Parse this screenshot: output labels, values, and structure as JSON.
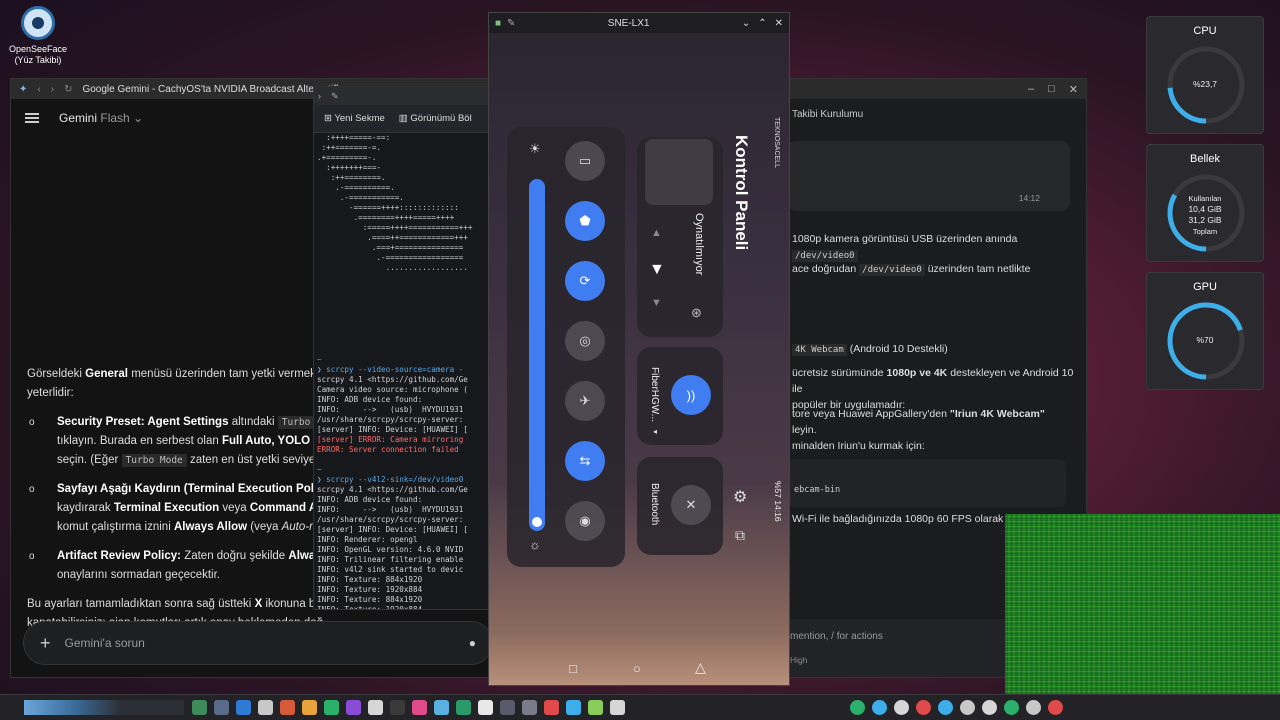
{
  "desktop": {
    "icon_label_1": "OpenSeeFace",
    "icon_label_2": "(Yüz Takibi)"
  },
  "browser": {
    "tab_title": "Google Gemini - CachyOS'ta NVIDIA Broadcast Alternatifle",
    "app_name": "Gemini",
    "model": "Flash",
    "intro": "menüsü üzerinden tam yetki vermek için",
    "intro_prefix": "Görseldeki",
    "intro_bold": "General",
    "intro_end": "yeterlidir:",
    "items": [
      {
        "title": "Security Preset: Agent Settings",
        "text1": "altındaki",
        "code": "Turbo Mo",
        "text2": "tıklayın. Burada en serbest olan",
        "b2": "Full Auto, YOLO Moc",
        "text3": "seçin. (Eğer",
        "code2": "Turbo Mode",
        "text4": "zaten en üst yetki seviyesi"
      },
      {
        "title": "Sayfayı Aşağı Kaydırın (Terminal Execution Policy):",
        "text1": "kaydırarak",
        "b1": "Terminal Execution",
        "text2": "veya",
        "b2": "Command Auto",
        "text3": "komut çalıştırma iznini",
        "b3": "Always Allow",
        "text4": "(veya",
        "i4": "Auto-run"
      },
      {
        "title": "Artifact Review Policy:",
        "text1": "Zaten doğru şekilde",
        "b1": "Always",
        "text2": "onaylarını sormadan geçecektir."
      }
    ],
    "closing_1": "Bu ayarları tamamladıktan sonra sağ üstteki",
    "closing_b": "X",
    "closing_2": "ikonuna basa",
    "closing_3": "kapatabilirsiniz; ajan komutları artık onay beklemeden doğ",
    "input_placeholder": "Gemini'a sorun"
  },
  "terminal": {
    "tab_new": "Yeni Sekme",
    "tab_split": "Görünümü Böl",
    "art": [
      "  :++++=====-==:",
      " :++=======-=.",
      ".+=========-.",
      "  :+++++++===-",
      "   :++========.",
      "    .-==========.",
      "     .-===========.",
      "       -======++++:::::::::::::",
      "        .========++++=====++++",
      "          :=====++++===========+++",
      "           .====++============+++",
      "            .===+===============",
      "             .-=================",
      "               .................."
    ],
    "lines": [
      {
        "t": "~",
        "c": "prompt"
      },
      {
        "t": "❯ scrcpy --video-source=camera -",
        "c": "prompt"
      },
      {
        "t": "scrcpy 4.1 <https://github.com/Ge",
        "c": ""
      },
      {
        "t": "Camera video source: microphone (",
        "c": ""
      },
      {
        "t": "INFO: ADB device found:",
        "c": ""
      },
      {
        "t": "INFO:     -->   (usb)  HVYDU1931",
        "c": ""
      },
      {
        "t": "/usr/share/scrcpy/scrcpy-server:",
        "c": ""
      },
      {
        "t": "[server] INFO: Device: [HUAWEI] [",
        "c": ""
      },
      {
        "t": "[server] ERROR: Camera mirroring",
        "c": "err"
      },
      {
        "t": "ERROR: Server connection failed",
        "c": "err"
      },
      {
        "t": "",
        "c": ""
      },
      {
        "t": "~",
        "c": "prompt"
      },
      {
        "t": "❯ scrcpy --v4l2-sink=/dev/video0",
        "c": "prompt"
      },
      {
        "t": "scrcpy 4.1 <https://github.com/Ge",
        "c": ""
      },
      {
        "t": "INFO: ADB device found:",
        "c": ""
      },
      {
        "t": "INFO:     -->   (usb)  HVYDU1931",
        "c": ""
      },
      {
        "t": "/usr/share/scrcpy/scrcpy-server:",
        "c": ""
      },
      {
        "t": "[server] INFO: Device: [HUAWEI] [",
        "c": ""
      },
      {
        "t": "INFO: Renderer: opengl",
        "c": ""
      },
      {
        "t": "INFO: OpenGL version: 4.6.0 NVID",
        "c": ""
      },
      {
        "t": "INFO: Trilinear filtering enable",
        "c": ""
      },
      {
        "t": "INFO: v4l2 sink started to devic",
        "c": ""
      },
      {
        "t": "INFO: Texture: 884x1920",
        "c": ""
      },
      {
        "t": "INFO: Texture: 1920x884",
        "c": ""
      },
      {
        "t": "INFO: Texture: 884x1920",
        "c": ""
      },
      {
        "t": "INFO: Texture: 1920x884",
        "c": ""
      },
      {
        "t": "INFO: Texture: 884x1920",
        "c": ""
      }
    ]
  },
  "phone": {
    "window_title": "SNE-LX1",
    "control_panel": "Kontrol Paneli",
    "carrier": "TEKNOSACELL",
    "not_playing": "Oynatılmıyor",
    "wifi_name": "FiberHGW...",
    "bluetooth": "Bluetooth",
    "status": "%57 14:16"
  },
  "docwin": {
    "header": "Takibi Kurulumu",
    "time": "14:12",
    "p1_a": "1080p kamera görüntüsü USB üzerinden anında",
    "p1_code": "/dev/video0",
    "p2_a": "ace doğrudan",
    "p2_code": "/dev/video0",
    "p2_b": "üzerinden tam netlikte",
    "h_code": "4K Webcam",
    "h_text": "(Android 10 Destekli)",
    "p3_a": "ücretsiz sürümünde",
    "p3_b": "1080p ve 4K",
    "p3_c": "destekleyen ve Android 10 ile",
    "p3_d": "popüler bir uygulamadır:",
    "p4_a": "tore veya Huawei AppGallery'den",
    "p4_b": "\"Iriun 4K Webcam\"",
    "p4_c": "leyin.",
    "p4_d": "minalden Iriun'u kurmak için:",
    "code_block": "ebcam-bin",
    "p5": "Wi-Fi ile bağladığınızda 1080p 60 FPS olarak kam",
    "input_hint": "mention, / for actions",
    "model": "High"
  },
  "gauges": {
    "cpu": {
      "title": "CPU",
      "value": "%23,7",
      "fraction": 0.237
    },
    "mem": {
      "title": "Bellek",
      "used_label": "Kullanılan",
      "used": "10,4 GiB",
      "total": "31,2 GiB",
      "total_label": "Toplam",
      "fraction": 0.333
    },
    "gpu": {
      "title": "GPU",
      "value": "%70",
      "fraction": 0.7
    },
    "accent": "#3daee9"
  }
}
